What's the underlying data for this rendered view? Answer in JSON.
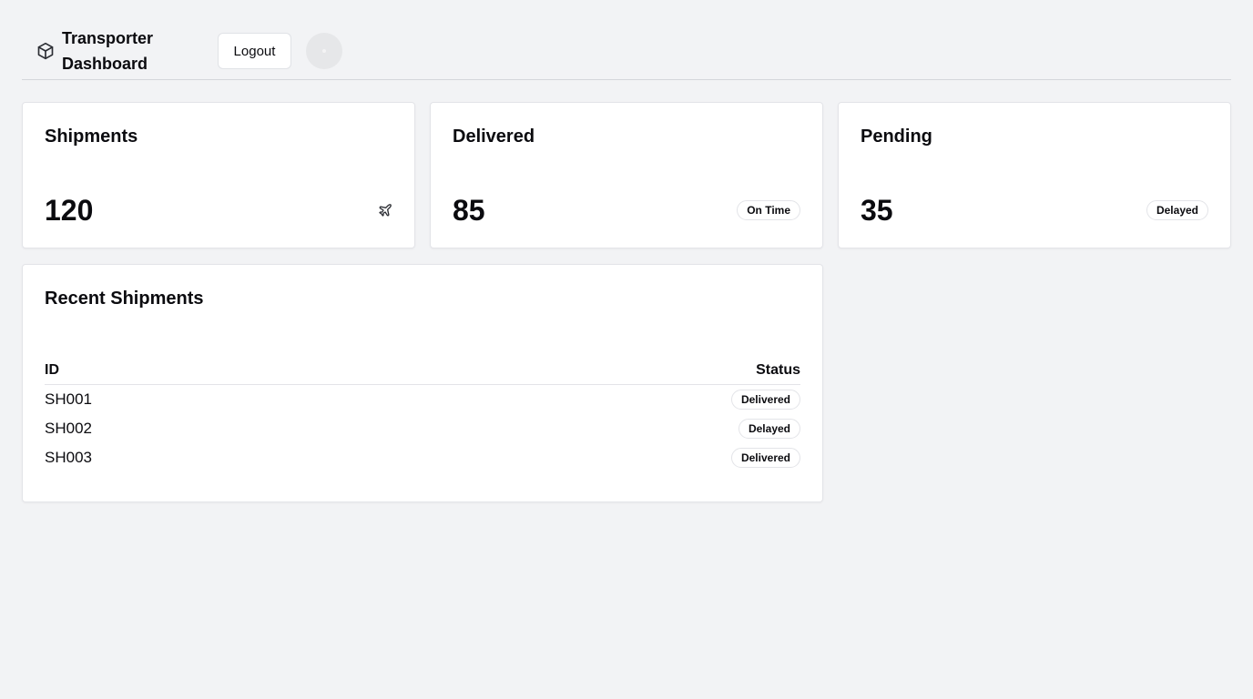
{
  "header": {
    "title": "Transporter Dashboard",
    "logout_label": "Logout"
  },
  "stats": [
    {
      "title": "Shipments",
      "value": "120",
      "icon": "plane-icon"
    },
    {
      "title": "Delivered",
      "value": "85",
      "badge": "On Time"
    },
    {
      "title": "Pending",
      "value": "35",
      "badge": "Delayed"
    }
  ],
  "recent": {
    "title": "Recent Shipments",
    "columns": [
      "ID",
      "Status"
    ],
    "rows": [
      {
        "id": "SH001",
        "status": "Delivered"
      },
      {
        "id": "SH002",
        "status": "Delayed"
      },
      {
        "id": "SH003",
        "status": "Delivered"
      }
    ]
  },
  "icons": {
    "brand": "package-icon",
    "shipments": "plane-icon"
  },
  "colors": {
    "background": "#f2f3f5",
    "card": "#ffffff",
    "text": "#0b0b0f",
    "border": "#e3e4e8"
  }
}
